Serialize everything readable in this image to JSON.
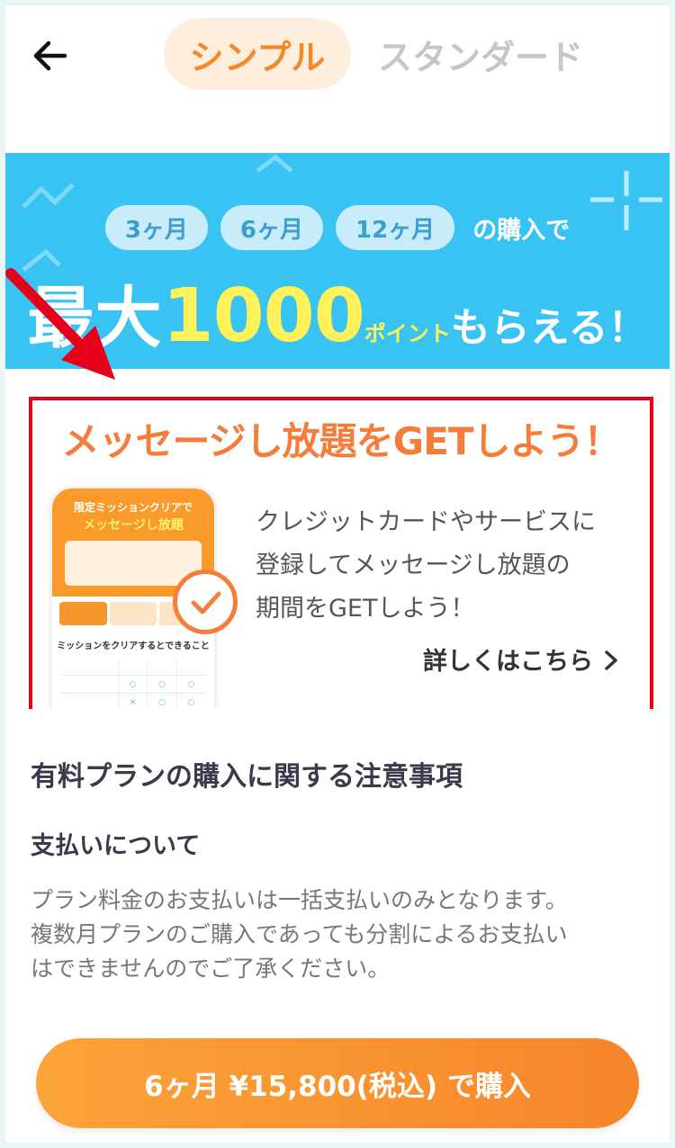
{
  "header": {
    "back_icon": "arrow-left-icon",
    "tabs": [
      {
        "label": "シンプル",
        "active": true
      },
      {
        "label": "スタンダード",
        "active": false
      }
    ]
  },
  "banner": {
    "pills": [
      "3ヶ月",
      "6ヶ月",
      "12ヶ月"
    ],
    "suffix": "の購入で",
    "main_prefix": "最大",
    "main_number": "1000",
    "main_unit": "ポイント",
    "main_rest": "もらえる！",
    "bg_color": "#38c3f2",
    "accent_color": "#fff15a"
  },
  "message_card": {
    "title": "メッセージし放題をGETしよう！",
    "phone": {
      "headline": "限定ミッションクリアで",
      "headline_accent": "メッセージし放題",
      "table_title": "ミッションをクリアするとできること"
    },
    "description_lines": [
      "クレジットカードやサービスに",
      "登録してメッセージし放題の",
      "期間をGETしよう！"
    ],
    "link_label": "詳しくはこちら",
    "link_icon": "chevron-right-icon",
    "border_color": "#e6001a",
    "title_color": "#f57d3c"
  },
  "notes": {
    "title": "有料プランの購入に関する注意事項",
    "payment_title": "支払いについて",
    "payment_lines": [
      "プラン料金のお支払いは一括支払いのみとなります。",
      "複数月プランのご購入であっても分割によるお支払い",
      "はできませんのでご了承ください。"
    ]
  },
  "purchase": {
    "label": "6ヶ月 ¥15,800(税込) で購入",
    "color": "#f6852a"
  }
}
